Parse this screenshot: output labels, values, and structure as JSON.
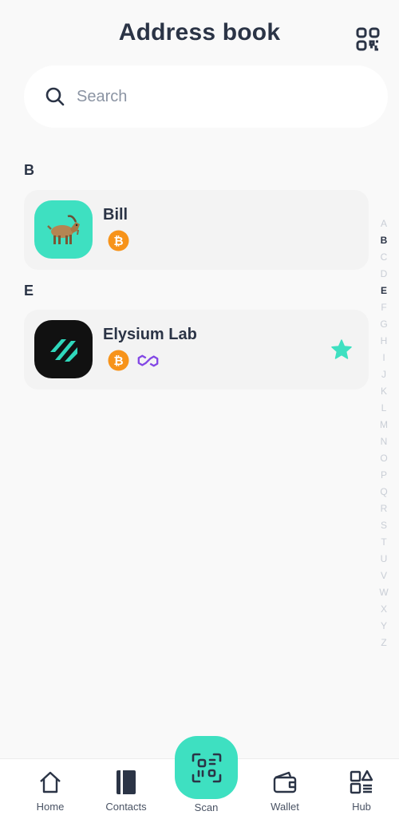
{
  "header": {
    "title": "Address book",
    "qr_icon": "qr-code-icon"
  },
  "search": {
    "placeholder": "Search",
    "value": ""
  },
  "sections": [
    {
      "letter": "B",
      "contacts": [
        {
          "name": "Bill",
          "avatar": "goat-emoji",
          "chains": [
            "bitcoin"
          ],
          "favorite": false
        }
      ]
    },
    {
      "letter": "E",
      "contacts": [
        {
          "name": "Elysium Lab",
          "avatar": "elysium-logo",
          "chains": [
            "bitcoin",
            "polygon"
          ],
          "favorite": true
        }
      ]
    }
  ],
  "alphabet": [
    "A",
    "B",
    "C",
    "D",
    "E",
    "F",
    "G",
    "H",
    "I",
    "J",
    "K",
    "L",
    "M",
    "N",
    "O",
    "P",
    "Q",
    "R",
    "S",
    "T",
    "U",
    "V",
    "W",
    "X",
    "Y",
    "Z"
  ],
  "alphabet_active": [
    "B",
    "E"
  ],
  "nav": {
    "home": "Home",
    "contacts": "Contacts",
    "scan": "Scan",
    "wallet": "Wallet",
    "hub": "Hub",
    "active": "contacts"
  },
  "colors": {
    "accent": "#3ee0c1",
    "bitcoin": "#f7931a",
    "polygon": "#8247e5",
    "star": "#3ee0c1",
    "text": "#2b3446"
  }
}
